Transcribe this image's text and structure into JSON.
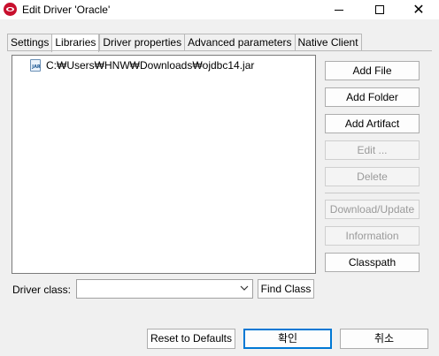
{
  "window": {
    "title": "Edit Driver 'Oracle'",
    "close_glyph": "✕",
    "accent_color": "#c8102e"
  },
  "tabs": [
    {
      "label": "Settings",
      "active": false
    },
    {
      "label": "Libraries",
      "active": true
    },
    {
      "label": "Driver properties",
      "active": false
    },
    {
      "label": "Advanced parameters",
      "active": false
    },
    {
      "label": "Native Client",
      "active": false
    }
  ],
  "libraries": {
    "items": [
      {
        "icon": "jar-file-icon",
        "icon_text": "JAR",
        "path": "C:₩Users₩HNW₩Downloads₩ojdbc14.jar"
      }
    ]
  },
  "side_buttons": {
    "add_file": "Add File",
    "add_folder": "Add Folder",
    "add_artifact": "Add Artifact",
    "edit": "Edit ...",
    "delete": "Delete",
    "download_update": "Download/Update",
    "information": "Information",
    "classpath": "Classpath"
  },
  "driver_class": {
    "label": "Driver class:",
    "value": "",
    "find_button": "Find Class"
  },
  "footer": {
    "reset": "Reset to Defaults",
    "ok": "확인",
    "cancel": "취소"
  }
}
